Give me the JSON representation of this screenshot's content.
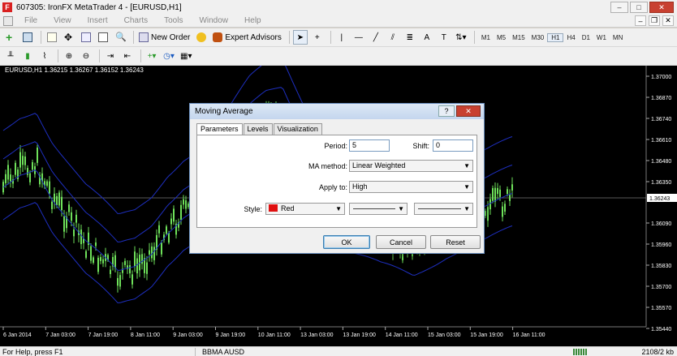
{
  "window": {
    "title": "607305: IronFX MetaTrader 4 - [EURUSD,H1]",
    "app_icon": "F",
    "min": "–",
    "max": "□",
    "close": "✕"
  },
  "menu": [
    "File",
    "View",
    "Insert",
    "Charts",
    "Tools",
    "Window",
    "Help"
  ],
  "mdi": {
    "min": "–",
    "restore": "❐",
    "close": "✕"
  },
  "toolbar": {
    "new_order": "New Order",
    "expert_advisors": "Expert Advisors",
    "timeframes": [
      "M1",
      "M5",
      "M15",
      "M30",
      "H1",
      "H4",
      "D1",
      "W1",
      "MN"
    ],
    "active_timeframe": "H1"
  },
  "chart": {
    "header": "EURUSD,H1  1.36215 1.36267 1.36152 1.36243",
    "price_labels": [
      "1.37000",
      "1.36870",
      "1.36740",
      "1.36610",
      "1.36480",
      "1.36350",
      "1.36243",
      "1.36090",
      "1.35960",
      "1.35830",
      "1.35700",
      "1.35570",
      "1.35440"
    ],
    "current_price": "1.36243",
    "time_labels": [
      "6 Jan 2014",
      "7 Jan 03:00",
      "7 Jan 19:00",
      "8 Jan 11:00",
      "9 Jan 03:00",
      "9 Jan 19:00",
      "10 Jan 11:00",
      "13 Jan 03:00",
      "13 Jan 19:00",
      "14 Jan 11:00",
      "15 Jan 03:00",
      "15 Jan 19:00",
      "16 Jan 11:00"
    ],
    "colors": {
      "background": "#000000",
      "candles": "#6ee05a",
      "bands": "#1e2fc0",
      "bid_line": "#b0b0b0"
    }
  },
  "dialog": {
    "title": "Moving Average",
    "help": "?",
    "close": "✕",
    "tabs": [
      "Parameters",
      "Levels",
      "Visualization"
    ],
    "period_label": "Period:",
    "period_value": "5",
    "shift_label": "Shift:",
    "shift_value": "0",
    "method_label": "MA method:",
    "method_value": "Linear Weighted",
    "apply_label": "Apply to:",
    "apply_value": "High",
    "style_label": "Style:",
    "style_color": "Red",
    "style_color_hex": "#e01010",
    "ok": "OK",
    "cancel": "Cancel",
    "reset": "Reset"
  },
  "status": {
    "help": "For Help, press F1",
    "profile": "BBMA AUSD",
    "traffic": "2108/2 kb"
  }
}
